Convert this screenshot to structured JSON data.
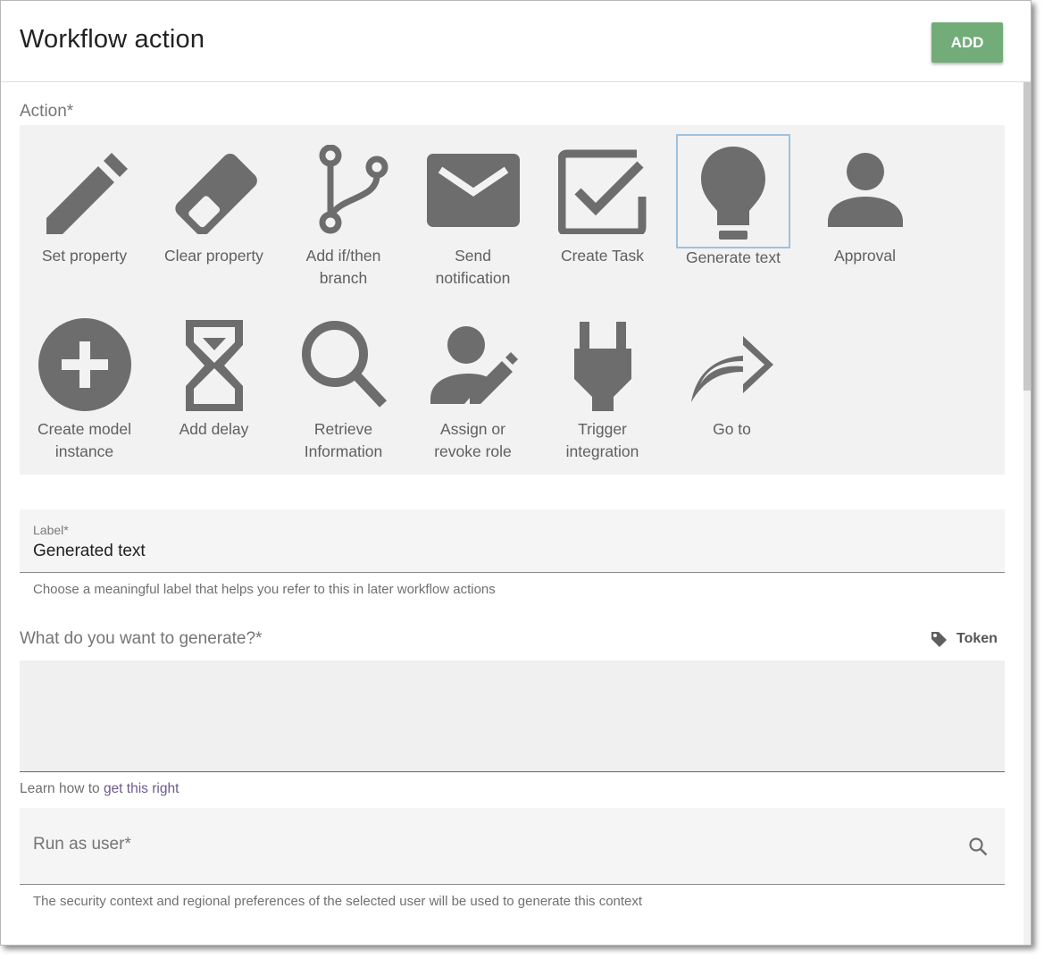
{
  "dialog": {
    "title": "Workflow action",
    "add_label": "ADD"
  },
  "action_section": {
    "label": "Action*",
    "tiles": [
      {
        "label_line1": "Set property",
        "label_line2": "",
        "icon": "pencil-icon"
      },
      {
        "label_line1": "Clear property",
        "label_line2": "",
        "icon": "eraser-icon"
      },
      {
        "label_line1": "Add if/then",
        "label_line2": "branch",
        "icon": "branch-icon"
      },
      {
        "label_line1": "Send",
        "label_line2": "notification",
        "icon": "envelope-icon"
      },
      {
        "label_line1": "Create Task",
        "label_line2": "",
        "icon": "checkbox-icon"
      },
      {
        "label_line1": "Generate text",
        "label_line2": "",
        "icon": "lightbulb-icon",
        "selected": true
      },
      {
        "label_line1": "Approval",
        "label_line2": "",
        "icon": "person-icon"
      },
      {
        "label_line1": "Create model",
        "label_line2": "instance",
        "icon": "plus-circle-icon"
      },
      {
        "label_line1": "Add delay",
        "label_line2": "",
        "icon": "hourglass-icon"
      },
      {
        "label_line1": "Retrieve",
        "label_line2": "Information",
        "icon": "magnifier-icon"
      },
      {
        "label_line1": "Assign or",
        "label_line2": "revoke role",
        "icon": "person-edit-icon"
      },
      {
        "label_line1": "Trigger",
        "label_line2": "integration",
        "icon": "plug-icon"
      },
      {
        "label_line1": "Go to",
        "label_line2": "",
        "icon": "redirect-arrow-icon"
      }
    ]
  },
  "label_field": {
    "label": "Label*",
    "value": "Generated text",
    "helper": "Choose a meaningful label that helps you refer to this in later workflow actions"
  },
  "generate_field": {
    "label": "What do you want to generate?*",
    "token_label": "Token",
    "value": "",
    "learn_prefix": "Learn how to ",
    "learn_link": "get this right"
  },
  "run_as_field": {
    "placeholder": "Run as user*",
    "helper": "The security context and regional preferences of the selected user will be used to generate this context"
  },
  "colors": {
    "accent_green": "#72ac79",
    "icon_gray": "#6d6d6d",
    "selected_border": "#9dc2e0",
    "link_purple": "#6c5a8c"
  }
}
